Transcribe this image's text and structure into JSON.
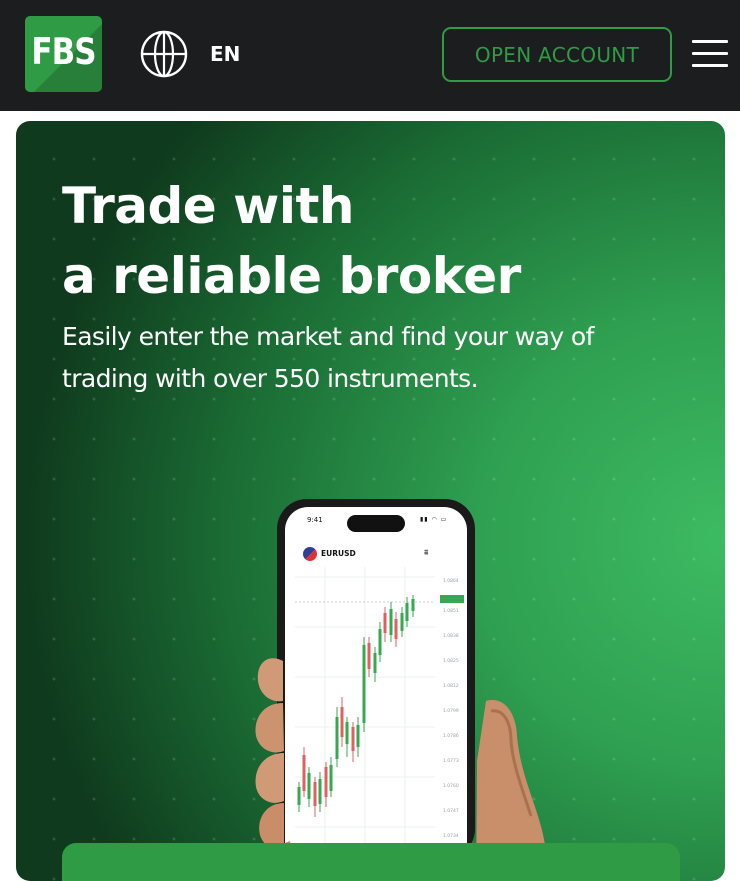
{
  "header": {
    "logo_text": "FBS",
    "language": "EN",
    "open_account_label": "OPEN ACCOUNT"
  },
  "hero": {
    "title_line1": "Trade with",
    "title_line2": "a reliable broker",
    "subtitle_line1": "Easily enter the market and find your way of",
    "subtitle_line2": "trading with over 550 instruments."
  },
  "phone": {
    "status_time": "9:41",
    "pair": "EURUSD"
  },
  "colors": {
    "brand_green": "#2f9b45",
    "header_bg": "#1c1d1f"
  },
  "icons": [
    "globe-icon",
    "hamburger-menu-icon",
    "chart-type-icon"
  ]
}
